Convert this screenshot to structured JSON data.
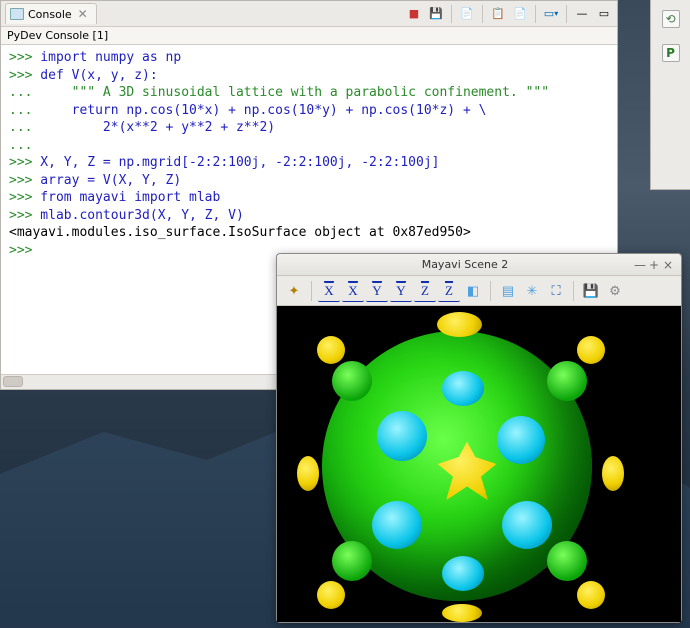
{
  "console": {
    "tab_title": "Console",
    "subheader": "PyDev Console [1]",
    "lines": [
      {
        "prompt": ">>>",
        "code": " import numpy as np"
      },
      {
        "prompt": ">>>",
        "code": " def V(x, y, z):"
      },
      {
        "prompt": "...",
        "code": "     \"\"\" A 3D sinusoidal lattice with a parabolic confinement. \"\"\""
      },
      {
        "prompt": "...",
        "code": "     return np.cos(10*x) + np.cos(10*y) + np.cos(10*z) + \\"
      },
      {
        "prompt": "...",
        "code": "         2*(x**2 + y**2 + z**2)"
      },
      {
        "prompt": "...",
        "code": ""
      },
      {
        "prompt": ">>>",
        "code": " X, Y, Z = np.mgrid[-2:2:100j, -2:2:100j, -2:2:100j]"
      },
      {
        "prompt": ">>>",
        "code": " array = V(X, Y, Z)"
      },
      {
        "prompt": ">>>",
        "code": " from mayavi import mlab"
      },
      {
        "prompt": ">>>",
        "code": " mlab.contour3d(X, Y, Z, V)"
      }
    ],
    "output": "<mayavi.modules.iso_surface.IsoSurface object at 0x87ed950>",
    "final_prompt": ">>>",
    "toolbar": {
      "stop": "■",
      "save": "💾",
      "clear": "📄",
      "pin": "📋",
      "doc": "📄",
      "menu": "▾",
      "min": "—",
      "max": "▭"
    }
  },
  "mayavi": {
    "title": "Mayavi Scene 2",
    "win": {
      "min": "—",
      "max": "+",
      "close": "×"
    },
    "toolbar": {
      "origin": "✦",
      "x1": "X",
      "x2": "X",
      "y1": "Y",
      "y2": "Y",
      "z1": "Z",
      "z2": "Z",
      "iso": "◧",
      "parallel": "▤",
      "axes": "✳",
      "full": "⛶",
      "save": "💾",
      "settings": "⚙"
    }
  },
  "sidebar": {
    "restore": "⟲",
    "p_badge": "P"
  }
}
